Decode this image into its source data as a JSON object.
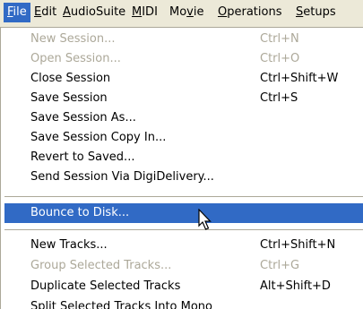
{
  "menubar": {
    "items": [
      {
        "label": "File",
        "acc": "F",
        "rest": "ile"
      },
      {
        "label": "Edit",
        "acc": "E",
        "rest": "dit"
      },
      {
        "label": "AudioSuite",
        "acc": "A",
        "rest": "udioSuite"
      },
      {
        "label": "MIDI",
        "acc": "M",
        "rest": "IDI"
      },
      {
        "label": "Movie",
        "pre": "Mo",
        "acc": "v",
        "rest": "ie"
      },
      {
        "label": "Operations",
        "acc": "O",
        "rest": "perations"
      },
      {
        "label": "Setups",
        "acc": "S",
        "rest": "etups"
      }
    ]
  },
  "file_menu": {
    "group1": [
      {
        "label": "New Session...",
        "shortcut": "Ctrl+N",
        "enabled": false
      },
      {
        "label": "Open Session...",
        "shortcut": "Ctrl+O",
        "enabled": false
      },
      {
        "label": "Close Session",
        "shortcut": "Ctrl+Shift+W",
        "enabled": true
      },
      {
        "label": "Save Session",
        "shortcut": "Ctrl+S",
        "enabled": true
      },
      {
        "label": "Save Session As...",
        "shortcut": "",
        "enabled": true
      },
      {
        "label": "Save Session Copy In...",
        "shortcut": "",
        "enabled": true
      },
      {
        "label": "Revert to Saved...",
        "shortcut": "",
        "enabled": true
      },
      {
        "label": "Send Session Via DigiDelivery...",
        "shortcut": "",
        "enabled": true
      }
    ],
    "group2": [
      {
        "label": "Bounce to Disk...",
        "shortcut": "",
        "enabled": true,
        "highlighted": true
      }
    ],
    "group3": [
      {
        "label": "New Tracks...",
        "shortcut": "Ctrl+Shift+N",
        "enabled": true
      },
      {
        "label": "Group Selected Tracks...",
        "shortcut": "Ctrl+G",
        "enabled": false
      },
      {
        "label": "Duplicate Selected Tracks",
        "shortcut": "Alt+Shift+D",
        "enabled": true
      },
      {
        "label": "Split Selected Tracks Into Mono",
        "shortcut": "",
        "enabled": true
      }
    ]
  },
  "colors": {
    "highlight": "#316ac5",
    "disabled_text": "#aca899",
    "menubar_bg": "#ece9d8"
  },
  "icons": {
    "cursor": "mouse-pointer-icon"
  }
}
